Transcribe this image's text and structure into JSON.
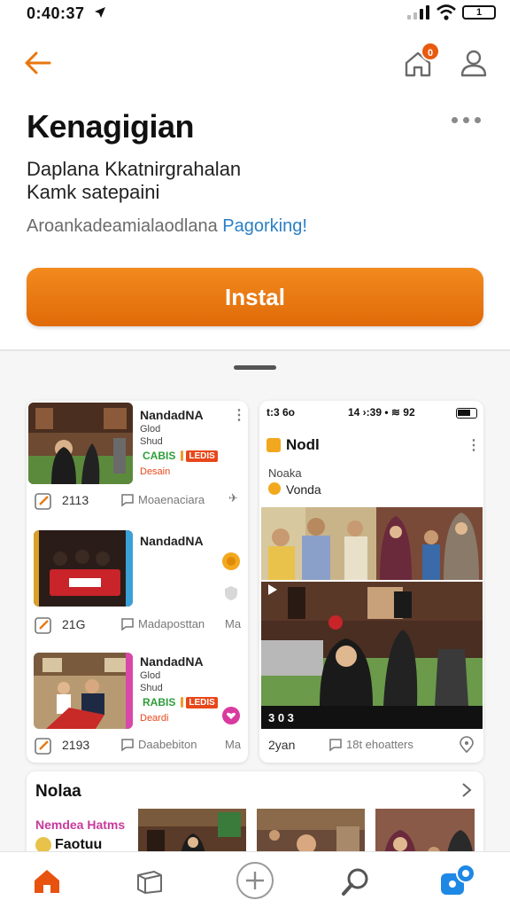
{
  "status_bar": {
    "time": "0:40:37",
    "battery": "1"
  },
  "header": {
    "notification_count": "0"
  },
  "app": {
    "title": "Kenagigian",
    "description_line1": "Daplana Kkatnirgrahalan",
    "description_line2": "Kamk satepaini",
    "tagline_prefix": "Aroankadeamialaodlana ",
    "tagline_link": "Pagorking!",
    "install_label": "Instal"
  },
  "feed_items": [
    {
      "title": "NandadNA",
      "line1": "Glod",
      "line2": "Shud",
      "tag1": "CABIS",
      "tag2": "LEDIS",
      "price": "Desain",
      "count": "2113",
      "comment": "Moaenaciara",
      "extra": "✈"
    },
    {
      "title": "NandadNA",
      "line1": "",
      "line2": "",
      "tag1": "",
      "tag2": "",
      "price": "",
      "count": "21G",
      "comment": "Madaposttan",
      "extra": "Ma"
    },
    {
      "title": "NandadNA",
      "line1": "Glod",
      "line2": "Shud",
      "tag1": "RABIS",
      "tag2": "LEDIS",
      "price": "Deardi",
      "count": "2193",
      "comment": "Daabebiton",
      "extra": "Ma"
    }
  ],
  "right_card": {
    "status_time": "t:3 6o",
    "status_right": "14 ›:39 • ≋ 92",
    "title": "Nodl",
    "sub1": "Noaka",
    "sub2": "Vonda",
    "media_counter": "3 0 3",
    "footer_left": "2yan",
    "footer_comment": "18t ehoatters"
  },
  "featured": {
    "title": "Nolaa",
    "label1": "Nemdea Hatms",
    "label2": "Faotuu"
  },
  "colors": {
    "accent": "#e8770f",
    "link": "#2a7fc6",
    "nav_active": "#e8520f"
  }
}
